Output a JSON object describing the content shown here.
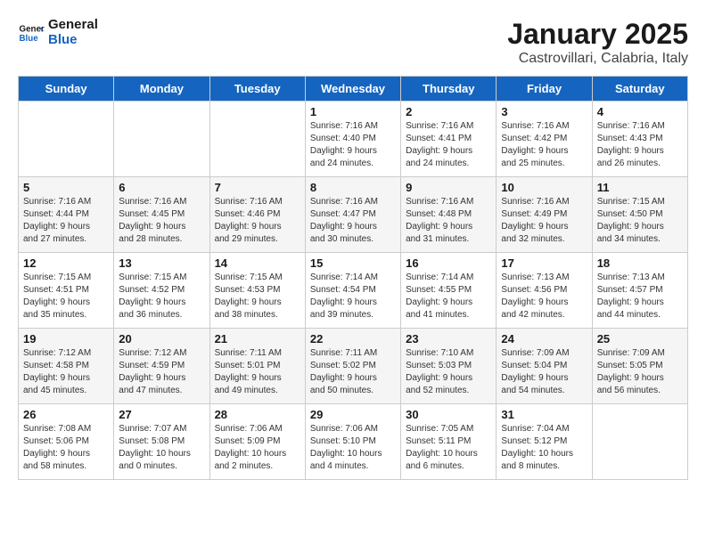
{
  "header": {
    "logo_general": "General",
    "logo_blue": "Blue",
    "title": "January 2025",
    "subtitle": "Castrovillari, Calabria, Italy"
  },
  "days_of_week": [
    "Sunday",
    "Monday",
    "Tuesday",
    "Wednesday",
    "Thursday",
    "Friday",
    "Saturday"
  ],
  "weeks": [
    [
      {
        "num": "",
        "detail": ""
      },
      {
        "num": "",
        "detail": ""
      },
      {
        "num": "",
        "detail": ""
      },
      {
        "num": "1",
        "detail": "Sunrise: 7:16 AM\nSunset: 4:40 PM\nDaylight: 9 hours\nand 24 minutes."
      },
      {
        "num": "2",
        "detail": "Sunrise: 7:16 AM\nSunset: 4:41 PM\nDaylight: 9 hours\nand 24 minutes."
      },
      {
        "num": "3",
        "detail": "Sunrise: 7:16 AM\nSunset: 4:42 PM\nDaylight: 9 hours\nand 25 minutes."
      },
      {
        "num": "4",
        "detail": "Sunrise: 7:16 AM\nSunset: 4:43 PM\nDaylight: 9 hours\nand 26 minutes."
      }
    ],
    [
      {
        "num": "5",
        "detail": "Sunrise: 7:16 AM\nSunset: 4:44 PM\nDaylight: 9 hours\nand 27 minutes."
      },
      {
        "num": "6",
        "detail": "Sunrise: 7:16 AM\nSunset: 4:45 PM\nDaylight: 9 hours\nand 28 minutes."
      },
      {
        "num": "7",
        "detail": "Sunrise: 7:16 AM\nSunset: 4:46 PM\nDaylight: 9 hours\nand 29 minutes."
      },
      {
        "num": "8",
        "detail": "Sunrise: 7:16 AM\nSunset: 4:47 PM\nDaylight: 9 hours\nand 30 minutes."
      },
      {
        "num": "9",
        "detail": "Sunrise: 7:16 AM\nSunset: 4:48 PM\nDaylight: 9 hours\nand 31 minutes."
      },
      {
        "num": "10",
        "detail": "Sunrise: 7:16 AM\nSunset: 4:49 PM\nDaylight: 9 hours\nand 32 minutes."
      },
      {
        "num": "11",
        "detail": "Sunrise: 7:15 AM\nSunset: 4:50 PM\nDaylight: 9 hours\nand 34 minutes."
      }
    ],
    [
      {
        "num": "12",
        "detail": "Sunrise: 7:15 AM\nSunset: 4:51 PM\nDaylight: 9 hours\nand 35 minutes."
      },
      {
        "num": "13",
        "detail": "Sunrise: 7:15 AM\nSunset: 4:52 PM\nDaylight: 9 hours\nand 36 minutes."
      },
      {
        "num": "14",
        "detail": "Sunrise: 7:15 AM\nSunset: 4:53 PM\nDaylight: 9 hours\nand 38 minutes."
      },
      {
        "num": "15",
        "detail": "Sunrise: 7:14 AM\nSunset: 4:54 PM\nDaylight: 9 hours\nand 39 minutes."
      },
      {
        "num": "16",
        "detail": "Sunrise: 7:14 AM\nSunset: 4:55 PM\nDaylight: 9 hours\nand 41 minutes."
      },
      {
        "num": "17",
        "detail": "Sunrise: 7:13 AM\nSunset: 4:56 PM\nDaylight: 9 hours\nand 42 minutes."
      },
      {
        "num": "18",
        "detail": "Sunrise: 7:13 AM\nSunset: 4:57 PM\nDaylight: 9 hours\nand 44 minutes."
      }
    ],
    [
      {
        "num": "19",
        "detail": "Sunrise: 7:12 AM\nSunset: 4:58 PM\nDaylight: 9 hours\nand 45 minutes."
      },
      {
        "num": "20",
        "detail": "Sunrise: 7:12 AM\nSunset: 4:59 PM\nDaylight: 9 hours\nand 47 minutes."
      },
      {
        "num": "21",
        "detail": "Sunrise: 7:11 AM\nSunset: 5:01 PM\nDaylight: 9 hours\nand 49 minutes."
      },
      {
        "num": "22",
        "detail": "Sunrise: 7:11 AM\nSunset: 5:02 PM\nDaylight: 9 hours\nand 50 minutes."
      },
      {
        "num": "23",
        "detail": "Sunrise: 7:10 AM\nSunset: 5:03 PM\nDaylight: 9 hours\nand 52 minutes."
      },
      {
        "num": "24",
        "detail": "Sunrise: 7:09 AM\nSunset: 5:04 PM\nDaylight: 9 hours\nand 54 minutes."
      },
      {
        "num": "25",
        "detail": "Sunrise: 7:09 AM\nSunset: 5:05 PM\nDaylight: 9 hours\nand 56 minutes."
      }
    ],
    [
      {
        "num": "26",
        "detail": "Sunrise: 7:08 AM\nSunset: 5:06 PM\nDaylight: 9 hours\nand 58 minutes."
      },
      {
        "num": "27",
        "detail": "Sunrise: 7:07 AM\nSunset: 5:08 PM\nDaylight: 10 hours\nand 0 minutes."
      },
      {
        "num": "28",
        "detail": "Sunrise: 7:06 AM\nSunset: 5:09 PM\nDaylight: 10 hours\nand 2 minutes."
      },
      {
        "num": "29",
        "detail": "Sunrise: 7:06 AM\nSunset: 5:10 PM\nDaylight: 10 hours\nand 4 minutes."
      },
      {
        "num": "30",
        "detail": "Sunrise: 7:05 AM\nSunset: 5:11 PM\nDaylight: 10 hours\nand 6 minutes."
      },
      {
        "num": "31",
        "detail": "Sunrise: 7:04 AM\nSunset: 5:12 PM\nDaylight: 10 hours\nand 8 minutes."
      },
      {
        "num": "",
        "detail": ""
      }
    ]
  ]
}
